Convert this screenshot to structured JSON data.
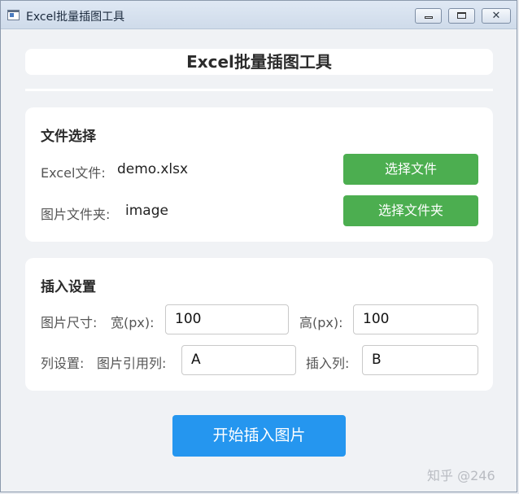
{
  "window": {
    "title": "Excel批量插图工具"
  },
  "header": {
    "title": "Excel批量插图工具"
  },
  "file_section": {
    "title": "文件选择",
    "excel_label": "Excel文件:",
    "excel_value": "demo.xlsx",
    "folder_label": "图片文件夹:",
    "folder_value": "image",
    "select_file_button": "选择文件",
    "select_folder_button": "选择文件夹"
  },
  "insert_section": {
    "title": "插入设置",
    "size_label": "图片尺寸:",
    "width_label": "宽(px):",
    "width_value": "100",
    "height_label": "高(px):",
    "height_value": "100",
    "column_label": "列设置:",
    "ref_column_label": "图片引用列:",
    "ref_column_value": "A",
    "insert_column_label": "插入列:",
    "insert_column_value": "B"
  },
  "actions": {
    "start_button": "开始插入图片"
  },
  "watermark": {
    "text": "知乎 @246"
  },
  "colors": {
    "green_button": "#4cae50",
    "blue_button": "#2596ef",
    "background": "#f0f2f5",
    "card": "#ffffff"
  },
  "icons": {
    "app": "window-app-icon",
    "minimize": "minimize-icon",
    "maximize": "maximize-icon",
    "close": "close-icon"
  }
}
